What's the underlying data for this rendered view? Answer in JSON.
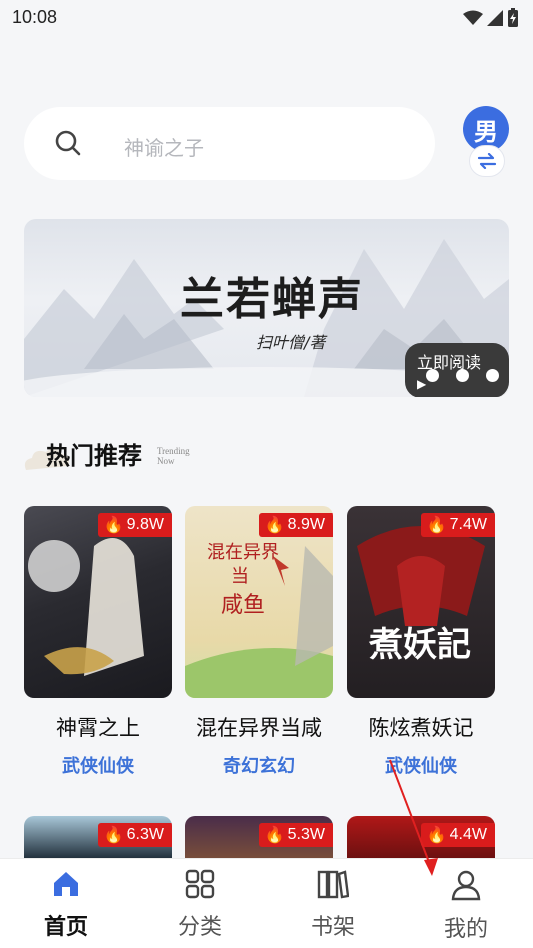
{
  "status": {
    "time": "10:08"
  },
  "search": {
    "placeholder": "神谕之子"
  },
  "gender": {
    "label": "男"
  },
  "banner": {
    "title": "兰若蝉声",
    "author": "扫叶僧/著",
    "read_label": "立即阅读"
  },
  "section": {
    "title": "热门推荐",
    "subtitle_line1": "Trending",
    "subtitle_line2": "Now"
  },
  "books_row1": [
    {
      "title": "神霄之上",
      "genre": "武侠仙侠",
      "heat": "9.8W"
    },
    {
      "title": "混在异界当咸",
      "genre": "奇幻玄幻",
      "heat": "8.9W"
    },
    {
      "title": "陈炫煮妖记",
      "genre": "武侠仙侠",
      "heat": "7.4W"
    }
  ],
  "books_row2": [
    {
      "heat": "6.3W"
    },
    {
      "heat": "5.3W"
    },
    {
      "heat": "4.4W"
    }
  ],
  "tabs": [
    {
      "label": "首页",
      "icon": "home-icon",
      "active": true
    },
    {
      "label": "分类",
      "icon": "grid-icon",
      "active": false
    },
    {
      "label": "书架",
      "icon": "bookshelf-icon",
      "active": false
    },
    {
      "label": "我的",
      "icon": "user-icon",
      "active": false
    }
  ],
  "colors": {
    "accent": "#3b6de0",
    "badge": "#d91c1c",
    "genre": "#3d72d8"
  }
}
